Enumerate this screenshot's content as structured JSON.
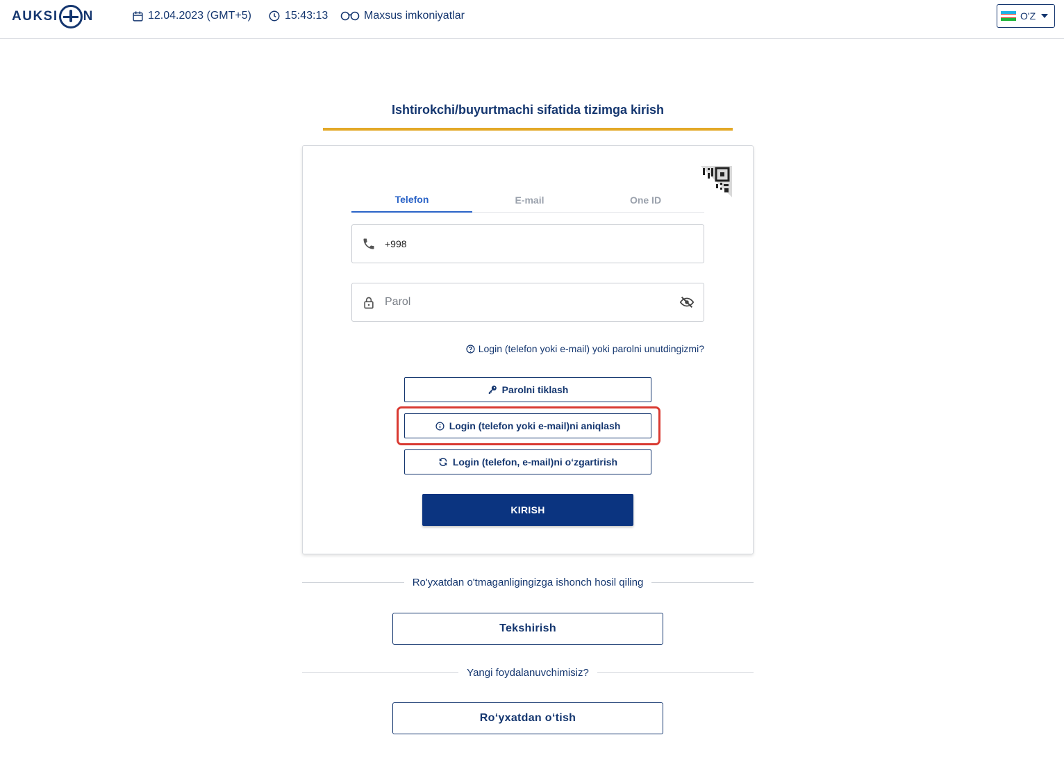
{
  "header": {
    "logo_text_left": "AUKSI",
    "logo_text_right": "N",
    "date": "12.04.2023 (GMT+5)",
    "time": "15:43:13",
    "accessibility": "Maxsus imkoniyatlar",
    "language": "O'Z",
    "flag_colors": [
      "#1eb2e6",
      "#ffffff",
      "#1eb53a"
    ]
  },
  "login": {
    "title": "Ishtirokchi/buyurtmachi sifatida tizimga kirish",
    "tabs": [
      {
        "label": "Telefon",
        "active": true
      },
      {
        "label": "E-mail",
        "active": false
      },
      {
        "label": "One ID",
        "active": false
      }
    ],
    "phone_prefix": "+998",
    "password_placeholder": "Parol",
    "forgot_link": "Login (telefon yoki e-mail) yoki parolni unutdingizmi?",
    "restore_password": "Parolni tiklash",
    "identify_login": "Login (telefon yoki e-mail)ni aniqlash",
    "change_login": "Login (telefon, e-mail)ni o‘zgartirish",
    "submit": "KIRISH"
  },
  "check": {
    "divider_text": "Ro'yxatdan o'tmaganligingizga ishonch hosil qiling",
    "button": "Tekshirish"
  },
  "register": {
    "divider_text": "Yangi foydalanuvchimisiz?",
    "button": "Ro‘yxatdan o‘tish"
  },
  "colors": {
    "brand": "#0b3480",
    "accent_underline": "#e3a928",
    "active_tab": "#2a63c7",
    "highlight": "#d93a32"
  }
}
